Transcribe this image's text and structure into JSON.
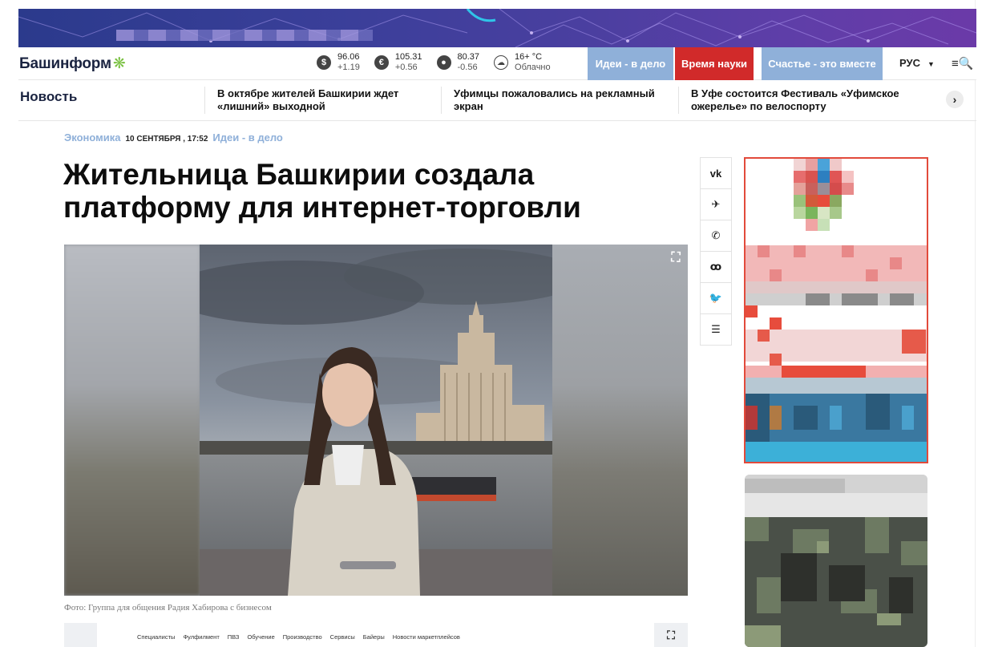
{
  "header": {
    "logo_text": "Башинформ",
    "logo_mark": "❋",
    "rates": [
      {
        "icon": "dollar-icon",
        "symbol": "$",
        "value": "96.06",
        "change": "+1.19"
      },
      {
        "icon": "euro-icon",
        "symbol": "€",
        "value": "105.31",
        "change": "+0.56"
      },
      {
        "icon": "oil-icon",
        "symbol": "●",
        "value": "80.37",
        "change": "-0.56"
      },
      {
        "icon": "weather-icon",
        "symbol": "☁",
        "value": "16+ °C",
        "change": "Облачно"
      }
    ],
    "pills": {
      "ideas": "Идеи - в дело",
      "science": "Время науки",
      "happy": "Счастье - это вместе"
    },
    "lang": "РУС",
    "lang_caret": "▼",
    "menu_icon": "≡🔍"
  },
  "ticker": {
    "label": "Новость",
    "items": [
      {
        "line1": "В октябре жителей Башкирии ждет",
        "line2": "«лишний» выходной"
      },
      {
        "line1": "Уфимцы пожаловались на рекламный",
        "line2": "экран"
      },
      {
        "line1": "В Уфе состоится Фестиваль «Уфимское",
        "line2": "ожерелье» по велоспорту"
      }
    ],
    "next_symbol": "›"
  },
  "article": {
    "rubric": "Экономика",
    "date": "10 СЕНТЯБРЯ , 17:52",
    "tag": "Идеи - в дело",
    "title": "Жительница Башкирии создала платформу для интернет-торговли",
    "caption": "Фото: Группа для общения Радия Хабирова с бизнесом",
    "expand_symbol": "⛶"
  },
  "strip": {
    "nav": [
      "Специалисты",
      "Фулфилмент",
      "ПВЗ",
      "Обучение",
      "Производство",
      "Сервисы",
      "Байеры",
      "Новости маркетплейсов"
    ],
    "expand_symbol": "⛶"
  },
  "share": [
    {
      "name": "vk-share-button",
      "symbol": "vk"
    },
    {
      "name": "telegram-share-button",
      "symbol": "✈"
    },
    {
      "name": "whatsapp-share-button",
      "symbol": "✆"
    },
    {
      "name": "odnoklassniki-share-button",
      "symbol": "ꚙ"
    },
    {
      "name": "twitter-share-button",
      "symbol": "🐦"
    },
    {
      "name": "news-share-button",
      "symbol": "☰"
    }
  ]
}
